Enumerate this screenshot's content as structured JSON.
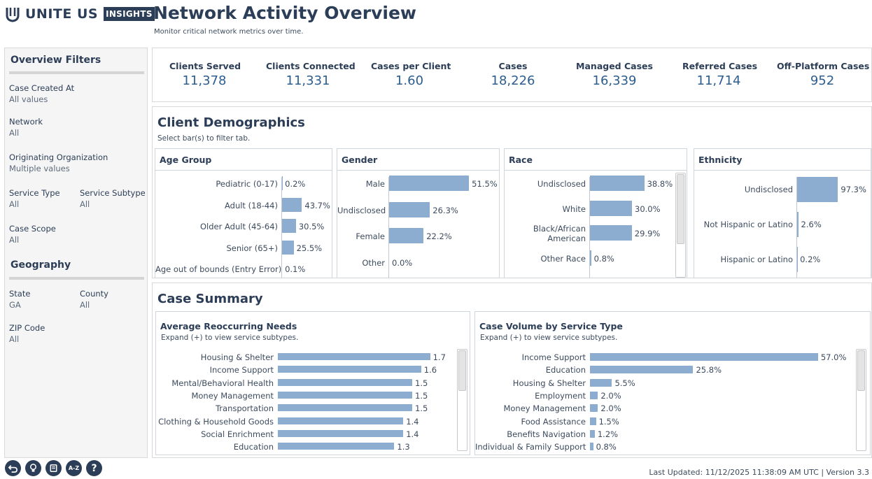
{
  "header": {
    "logo_text": "UNITE US",
    "logo_badge": "INSIGHTS",
    "title": "Network Activity Overview",
    "subtitle": "Monitor critical network metrics over time."
  },
  "sidebar": {
    "filters_heading": "Overview Filters",
    "case_created_label": "Case Created At",
    "case_created_value": "All values",
    "network_label": "Network",
    "network_value": "All",
    "orig_org_label": "Originating Organization",
    "orig_org_value": "Multiple values",
    "service_type_label": "Service Type",
    "service_type_value": "All",
    "service_subtype_label": "Service Subtype",
    "service_subtype_value": "All",
    "case_scope_label": "Case Scope",
    "case_scope_value": "All",
    "geo_heading": "Geography",
    "state_label": "State",
    "state_value": "GA",
    "county_label": "County",
    "county_value": "All",
    "zip_label": "ZIP Code",
    "zip_value": "All"
  },
  "kpis": [
    {
      "label": "Clients Served",
      "value": "11,378"
    },
    {
      "label": "Clients Connected",
      "value": "11,331"
    },
    {
      "label": "Cases per Client",
      "value": "1.60"
    },
    {
      "label": "Cases",
      "value": "18,226"
    },
    {
      "label": "Managed Cases",
      "value": "16,339"
    },
    {
      "label": "Referred Cases",
      "value": "11,714"
    },
    {
      "label": "Off-Platform Cases",
      "value": "952"
    }
  ],
  "demographics": {
    "title": "Client Demographics",
    "subtitle": "Select bar(s) to filter tab.",
    "age": {
      "title": "Age Group",
      "rows": [
        {
          "label": "Pediatric (0-17)",
          "value": 0.2,
          "text": "0.2%"
        },
        {
          "label": "Adult (18-44)",
          "value": 43.7,
          "text": "43.7%"
        },
        {
          "label": "Older Adult (45-64)",
          "value": 30.5,
          "text": "30.5%"
        },
        {
          "label": "Senior (65+)",
          "value": 25.5,
          "text": "25.5%"
        },
        {
          "label": "Age out of bounds (Entry Error)",
          "value": 0.1,
          "text": "0.1%"
        }
      ]
    },
    "gender": {
      "title": "Gender",
      "rows": [
        {
          "label": "Male",
          "value": 51.5,
          "text": "51.5%"
        },
        {
          "label": "Undisclosed",
          "value": 26.3,
          "text": "26.3%"
        },
        {
          "label": "Female",
          "value": 22.2,
          "text": "22.2%"
        },
        {
          "label": "Other",
          "value": 0.0,
          "text": "0.0%"
        }
      ]
    },
    "race": {
      "title": "Race",
      "rows": [
        {
          "label": "Undisclosed",
          "value": 38.8,
          "text": "38.8%"
        },
        {
          "label": "White",
          "value": 30.0,
          "text": "30.0%"
        },
        {
          "label": "Black/African",
          "label2": "American",
          "value": 29.9,
          "text": "29.9%"
        },
        {
          "label": "Other Race",
          "value": 0.8,
          "text": "0.8%"
        }
      ]
    },
    "ethnicity": {
      "title": "Ethnicity",
      "rows": [
        {
          "label": "Undisclosed",
          "value": 97.3,
          "text": "97.3%"
        },
        {
          "label": "Not Hispanic or Latino",
          "value": 2.6,
          "text": "2.6%"
        },
        {
          "label": "Hispanic or Latino",
          "value": 0.2,
          "text": "0.2%"
        }
      ]
    }
  },
  "case_summary": {
    "title": "Case Summary",
    "needs": {
      "title": "Average Reoccurring Needs",
      "subtitle": "Expand (+) to view service subtypes.",
      "rows": [
        {
          "label": "Housing & Shelter",
          "value": 1.7,
          "text": "1.7"
        },
        {
          "label": "Income Support",
          "value": 1.6,
          "text": "1.6"
        },
        {
          "label": "Mental/Behavioral Health",
          "value": 1.5,
          "text": "1.5"
        },
        {
          "label": "Money Management",
          "value": 1.5,
          "text": "1.5"
        },
        {
          "label": "Transportation",
          "value": 1.5,
          "text": "1.5"
        },
        {
          "label": "Clothing & Household Goods",
          "value": 1.4,
          "text": "1.4"
        },
        {
          "label": "Social Enrichment",
          "value": 1.4,
          "text": "1.4"
        },
        {
          "label": "Education",
          "value": 1.3,
          "text": "1.3"
        }
      ]
    },
    "volume": {
      "title": "Case Volume by Service Type",
      "subtitle": "Expand (+) to view service subtypes.",
      "rows": [
        {
          "label": "Income Support",
          "value": 57.0,
          "text": "57.0%"
        },
        {
          "label": "Education",
          "value": 25.8,
          "text": "25.8%"
        },
        {
          "label": "Housing & Shelter",
          "value": 5.5,
          "text": "5.5%"
        },
        {
          "label": "Employment",
          "value": 2.0,
          "text": "2.0%"
        },
        {
          "label": "Money Management",
          "value": 2.0,
          "text": "2.0%"
        },
        {
          "label": "Food Assistance",
          "value": 1.5,
          "text": "1.5%"
        },
        {
          "label": "Benefits Navigation",
          "value": 1.2,
          "text": "1.2%"
        },
        {
          "label": "Individual & Family Support",
          "value": 0.8,
          "text": "0.8%"
        }
      ]
    }
  },
  "footer": {
    "icons": [
      "back-icon",
      "lightbulb-icon",
      "document-icon",
      "az-icon",
      "help-icon"
    ],
    "az_label": "A-Z",
    "help_label": "?",
    "last_updated": "Last Updated: 11/12/2025 11:38:09 AM UTC  |  Version 3.3"
  },
  "colors": {
    "bar": "#8cacd0",
    "navy": "#2c3e57",
    "kpi_value": "#2c5d8f"
  }
}
